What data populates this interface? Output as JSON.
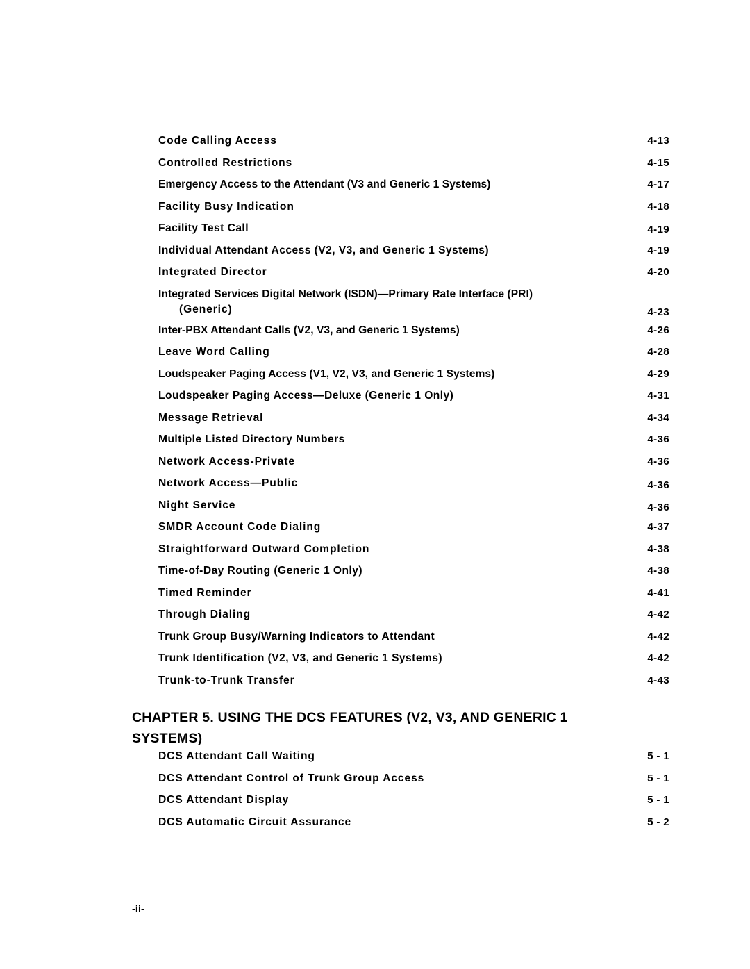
{
  "document": {
    "type": "table-of-contents",
    "folio": "-ii-"
  },
  "toc": {
    "chapter4_entries": [
      {
        "title": "Code  Calling  Access",
        "page": "4-13"
      },
      {
        "title": "Controlled  Restrictions",
        "page": "4-15"
      },
      {
        "title": "Emergency Access to the Attendant (V3 and Generic 1 Systems)",
        "page": "4-17"
      },
      {
        "title": "Facility  Busy  Indication",
        "page": "4-18"
      },
      {
        "title": "Facility Test Call",
        "page": "4-19"
      },
      {
        "title": "Individual  Attendant  Access  (V2,  V3,  and  Generic  1  Systems)",
        "page": "4-19"
      },
      {
        "title": "Integrated  Director",
        "page": "4-20"
      },
      {
        "title": "Integrated Services Digital Network (ISDN)—Primary Rate Interface (PRI)",
        "continuation": "(Generic)",
        "page": "4-23"
      },
      {
        "title": "Inter-PBX Attendant Calls (V2, V3, and Generic 1 Systems)",
        "page": "4-26"
      },
      {
        "title": "Leave  Word  Calling",
        "page": "4-28"
      },
      {
        "title": "Loudspeaker Paging Access (V1, V2, V3, and Generic 1 Systems)",
        "page": "4-29"
      },
      {
        "title": "Loudspeaker  Paging  Access—Deluxe  (Generic  1  Only)",
        "page": "4-31"
      },
      {
        "title": "Message  Retrieval",
        "page": "4-34"
      },
      {
        "title": "Multiple Listed Directory Numbers",
        "page": "4-36"
      },
      {
        "title": "Network  Access-Private",
        "page": "4-36"
      },
      {
        "title": "Network  Access—Public",
        "page": "4-36"
      },
      {
        "title": "Night  Service",
        "page": "4-36"
      },
      {
        "title": "SMDR  Account  Code  Dialing",
        "page": "4-37"
      },
      {
        "title": "Straightforward  Outward  Completion",
        "page": "4-38"
      },
      {
        "title": "Time-of-Day  Routing  (Generic  1  Only)",
        "page": "4-38"
      },
      {
        "title": "Timed  Reminder",
        "page": "4-41"
      },
      {
        "title": "Through  Dialing",
        "page": "4-42"
      },
      {
        "title": "Trunk Group Busy/Warning Indicators to Attendant",
        "page": "4-42"
      },
      {
        "title": "Trunk  Identification  (V2,  V3,  and  Generic  1  Systems)",
        "page": "4-42"
      },
      {
        "title": "Trunk-to-Trunk Transfer",
        "page": "4-43"
      }
    ],
    "chapter5_heading": "CHAPTER 5. USING THE DCS FEATURES (V2, V3, AND GENERIC 1 SYSTEMS)",
    "chapter5_entries": [
      {
        "title": "DCS  Attendant  Call  Waiting",
        "page": "5 - 1"
      },
      {
        "title": "DCS  Attendant  Control  of  Trunk  Group  Access",
        "page": "5 - 1"
      },
      {
        "title": "DCS  Attendant  Display",
        "page": "5 - 1"
      },
      {
        "title": "DCS  Automatic  Circuit  Assurance",
        "page": "5 - 2"
      }
    ]
  }
}
